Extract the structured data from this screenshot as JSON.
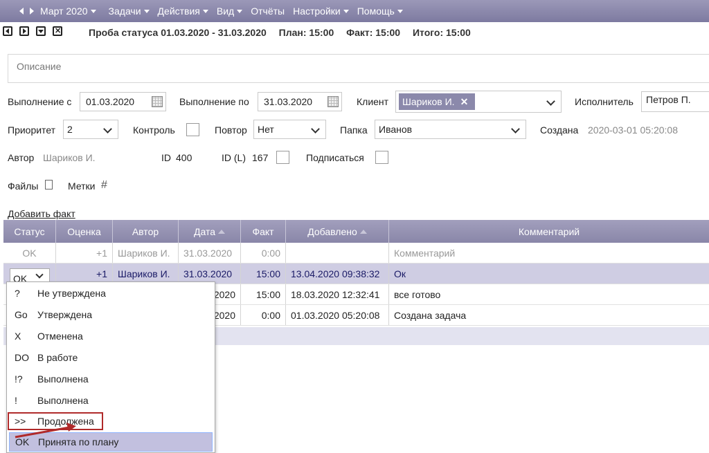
{
  "menubar": {
    "month": "Март 2020",
    "items": [
      "Задачи",
      "Действия",
      "Вид",
      "Отчёты",
      "Настройки",
      "Помощь"
    ]
  },
  "header": {
    "title": "Проба статуса 01.03.2020 - 31.03.2020",
    "plan": "План: 15:00",
    "fact": "Факт: 15:00",
    "total": "Итого: 15:00"
  },
  "description_placeholder": "Описание",
  "form": {
    "exec_from_label": "Выполнение с",
    "exec_from_value": "01.03.2020",
    "exec_to_label": "Выполнение по",
    "exec_to_value": "31.03.2020",
    "client_label": "Клиент",
    "client_token": "Шариков И.",
    "executor_label": "Исполнитель",
    "executor_value": "Петров П.",
    "priority_label": "Приоритет",
    "priority_value": "2",
    "control_label": "Контроль",
    "repeat_label": "Повтор",
    "repeat_value": "Нет",
    "folder_label": "Папка",
    "folder_value": "Иванов",
    "created_label": "Создана",
    "created_value": "2020-03-01 05:20:08",
    "author_label": "Автор",
    "author_value": "Шариков И.",
    "id_label": "ID",
    "id_value": "400",
    "idl_label": "ID (L)",
    "idl_value": "167",
    "subscribe_label": "Подписаться",
    "files_label": "Файлы",
    "tags_label": "Метки",
    "add_fact": "Добавить факт"
  },
  "table": {
    "headers": [
      "Статус",
      "Оценка",
      "Автор",
      "Дата",
      "Факт",
      "Добавлено",
      "Комментарий"
    ],
    "rows": [
      {
        "status": "OK",
        "score": "+1",
        "author": "Шариков И.",
        "date": "31.03.2020",
        "fact": "0:00",
        "added": "",
        "comment": "Комментарий"
      },
      {
        "status": "OK",
        "score": "+1",
        "author": "Шариков И.",
        "date": "31.03.2020",
        "fact": "15:00",
        "added": "13.04.2020 09:38:32",
        "comment": "Ок"
      },
      {
        "status": "",
        "score": "",
        "author": "",
        "date": "2020",
        "fact": "15:00",
        "added": "18.03.2020 12:32:41",
        "comment": "все готово"
      },
      {
        "status": "",
        "score": "",
        "author": "",
        "date": "2020",
        "fact": "0:00",
        "added": "01.03.2020 05:20:08",
        "comment": "Создана задача"
      }
    ]
  },
  "status_dropdown": {
    "current": "OK",
    "options": [
      {
        "code": "?",
        "label": "Не утверждена"
      },
      {
        "code": "Go",
        "label": "Утверждена"
      },
      {
        "code": "X",
        "label": "Отменена"
      },
      {
        "code": "DO",
        "label": "В работе"
      },
      {
        "code": "!?",
        "label": "Выполнена"
      },
      {
        "code": "!",
        "label": "Выполнена"
      },
      {
        "code": ">>",
        "label": "Продолжена"
      },
      {
        "code": "OK",
        "label": "Принята по плану"
      }
    ]
  },
  "colors": {
    "menubar": "#8b89ab",
    "highlight_box": "#b02a2a",
    "selected_row": "#cfcde3"
  }
}
